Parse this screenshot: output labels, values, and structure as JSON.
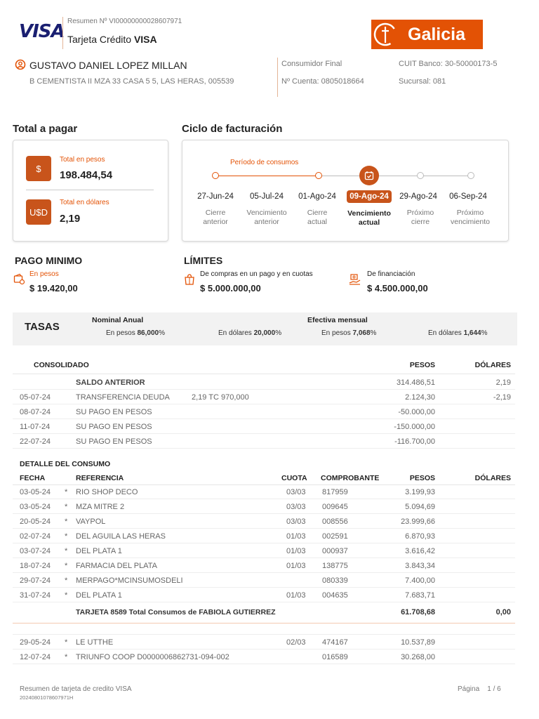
{
  "header": {
    "brand": "VISA",
    "resumen": "Resumen Nº VI00000000028607971",
    "card_type_prefix": "Tarjeta Crédito",
    "card_type_brand": "VISA",
    "bank_name": "Galicia",
    "holder_name": "GUSTAVO DANIEL LOPEZ MILLAN",
    "address": "B CEMENTISTA II MZA 33 CASA 5 5, LAS HERAS, 005539",
    "consumer_type": "Consumidor Final",
    "account": "Nº Cuenta: 0805018664",
    "cuit": "CUIT Banco: 30-50000173-5",
    "branch": "Sucursal: 081"
  },
  "total": {
    "title": "Total a pagar",
    "pesos_label": "Total en pesos",
    "pesos_value": "198.484,54",
    "pesos_icon": "$",
    "usd_label": "Total en dólares",
    "usd_value": "2,19",
    "usd_icon": "U$D"
  },
  "cycle": {
    "title": "Ciclo de facturación",
    "period_label": "Período de consumos",
    "items": [
      {
        "date": "27-Jun-24",
        "label1": "Cierre",
        "label2": "anterior"
      },
      {
        "date": "05-Jul-24",
        "label1": "Vencimiento",
        "label2": "anterior"
      },
      {
        "date": "01-Ago-24",
        "label1": "Cierre",
        "label2": "actual"
      },
      {
        "date": "09-Ago-24",
        "label1": "Vencimiento",
        "label2": "actual"
      },
      {
        "date": "29-Ago-24",
        "label1": "Próximo",
        "label2": "cierre"
      },
      {
        "date": "06-Sep-24",
        "label1": "Próximo",
        "label2": "vencimiento"
      }
    ],
    "accent": "#e35205"
  },
  "minimum": {
    "title": "PAGO MINIMO",
    "label": "En pesos",
    "value": "$ 19.420,00"
  },
  "limits": {
    "title": "LÍMITES",
    "purchase_label": "De compras en un pago y en cuotas",
    "purchase_value": "$ 5.000.000,00",
    "financing_label": "De financiación",
    "financing_value": "$ 4.500.000,00"
  },
  "rates": {
    "title": "TASAS",
    "nominal_title": "Nominal Anual",
    "effective_title": "Efectiva mensual",
    "nominal_pesos_label": "En pesos",
    "nominal_pesos_value": "86,000",
    "nominal_usd_label": "En dólares",
    "nominal_usd_value": "20,000",
    "effective_pesos_label": "En pesos",
    "effective_pesos_value": "7,068",
    "effective_usd_label": "En dólares",
    "effective_usd_value": "1,644",
    "percent": "%"
  },
  "consolidated": {
    "title": "CONSOLIDADO",
    "col_pesos": "PESOS",
    "col_usd": "DÓLARES",
    "rows": [
      {
        "date": "",
        "ref": "SALDO ANTERIOR",
        "extra": "",
        "pesos": "314.486,51",
        "usd": "2,19"
      },
      {
        "date": "05-07-24",
        "ref": "TRANSFERENCIA DEUDA",
        "extra": "2,19 TC 970,000",
        "pesos": "2.124,30",
        "usd": "-2,19"
      },
      {
        "date": "08-07-24",
        "ref": "SU PAGO EN PESOS",
        "extra": "",
        "pesos": "-50.000,00",
        "usd": ""
      },
      {
        "date": "11-07-24",
        "ref": "SU PAGO EN PESOS",
        "extra": "",
        "pesos": "-150.000,00",
        "usd": ""
      },
      {
        "date": "22-07-24",
        "ref": "SU PAGO EN PESOS",
        "extra": "",
        "pesos": "-116.700,00",
        "usd": ""
      }
    ]
  },
  "detail": {
    "title": "DETALLE DEL CONSUMO",
    "col_date": "FECHA",
    "col_ref": "REFERENCIA",
    "col_quota": "CUOTA",
    "col_voucher": "COMPROBANTE",
    "col_pesos": "PESOS",
    "col_usd": "DÓLARES",
    "rows": [
      {
        "date": "03-05-24",
        "mark": "*",
        "ref": "RIO SHOP DECO",
        "quota": "03/03",
        "voucher": "817959",
        "pesos": "3.199,93",
        "usd": ""
      },
      {
        "date": "03-05-24",
        "mark": "*",
        "ref": "MZA MITRE 2",
        "quota": "03/03",
        "voucher": "009645",
        "pesos": "5.094,69",
        "usd": ""
      },
      {
        "date": "20-05-24",
        "mark": "*",
        "ref": "VAYPOL",
        "quota": "03/03",
        "voucher": "008556",
        "pesos": "23.999,66",
        "usd": ""
      },
      {
        "date": "02-07-24",
        "mark": "*",
        "ref": "DEL AGUILA LAS HERAS",
        "quota": "01/03",
        "voucher": "002591",
        "pesos": "6.870,93",
        "usd": ""
      },
      {
        "date": "03-07-24",
        "mark": "*",
        "ref": "DEL PLATA 1",
        "quota": "01/03",
        "voucher": "000937",
        "pesos": "3.616,42",
        "usd": ""
      },
      {
        "date": "18-07-24",
        "mark": "*",
        "ref": "FARMACIA DEL PLATA",
        "quota": "01/03",
        "voucher": "138775",
        "pesos": "3.843,34",
        "usd": ""
      },
      {
        "date": "29-07-24",
        "mark": "*",
        "ref": "MERPAGO*MCINSUMOSDELI",
        "quota": "",
        "voucher": "080339",
        "pesos": "7.400,00",
        "usd": ""
      },
      {
        "date": "31-07-24",
        "mark": "*",
        "ref": "DEL PLATA 1",
        "quota": "01/03",
        "voucher": "004635",
        "pesos": "7.683,71",
        "usd": ""
      }
    ],
    "subtotal_label": "TARJETA 8589 Total Consumos de FABIOLA GUTIERREZ",
    "subtotal_pesos": "61.708,68",
    "subtotal_usd": "0,00",
    "rows2": [
      {
        "date": "29-05-24",
        "mark": "*",
        "ref": "LE UTTHE",
        "quota": "02/03",
        "voucher": "474167",
        "pesos": "10.537,89",
        "usd": ""
      },
      {
        "date": "12-07-24",
        "mark": "*",
        "ref": "TRIUNFO COOP D0000006862731-094-002",
        "quota": "",
        "voucher": "016589",
        "pesos": "30.268,00",
        "usd": ""
      }
    ]
  },
  "footer": {
    "doc_title": "Resumen de tarjeta de credito VISA",
    "doc_code": "20240801078607971H",
    "page_label": "Página",
    "page_value": "1 / 6"
  }
}
